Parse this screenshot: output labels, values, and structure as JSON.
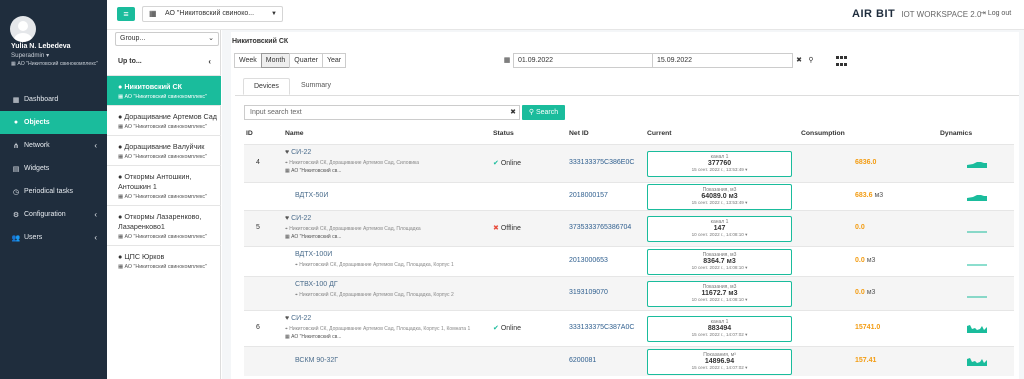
{
  "user": {
    "name": "Yulia N. Lebedeva",
    "role": "Superadmin ▾",
    "org": "АО \"Никитовский свинокомплекс\""
  },
  "menu": [
    {
      "label": "Dashboard",
      "icon": "dashboard-icon",
      "glyph": "▦",
      "arrow": ""
    },
    {
      "label": "Objects",
      "icon": "map-pin-icon",
      "glyph": "●",
      "arrow": ""
    },
    {
      "label": "Network",
      "icon": "network-icon",
      "glyph": "⋔",
      "arrow": "‹"
    },
    {
      "label": "Widgets",
      "icon": "widgets-icon",
      "glyph": "▤",
      "arrow": ""
    },
    {
      "label": "Periodical tasks",
      "icon": "clock-icon",
      "glyph": "◷",
      "arrow": ""
    },
    {
      "label": "Configuration",
      "icon": "gear-icon",
      "glyph": "⚙",
      "arrow": "‹"
    },
    {
      "label": "Users",
      "icon": "users-icon",
      "glyph": "👥",
      "arrow": "‹"
    }
  ],
  "topbar": {
    "org_select": "АО \"Никитовский свиноко...",
    "brand": "AIR BIT",
    "workspace": "IOT WORKSPACE 2.0",
    "logout": "Log out"
  },
  "groups": {
    "select": "Group...",
    "up_to": "Up to...",
    "items": [
      {
        "name": "Никитовский СК",
        "org": "АО \"Никитовский свинокомплекс\""
      },
      {
        "name": "Доращивание Артемов Сад",
        "org": "АО \"Никитовский свинокомплекс\""
      },
      {
        "name": "Доращивание Валуйчик",
        "org": "АО \"Никитовский свинокомплекс\""
      },
      {
        "name": "Откормы Антошкин, Антошкин 1",
        "org": "АО \"Никитовский свинокомплекс\""
      },
      {
        "name": "Откормы Лазаренково, Лазаренково1",
        "org": "АО \"Никитовский свинокомплекс\""
      },
      {
        "name": "ЦПС Юрков",
        "org": "АО \"Никитовский свинокомплекс\""
      }
    ]
  },
  "content": {
    "title": "Никитовский СК",
    "periods": [
      "Week",
      "Month",
      "Quarter",
      "Year"
    ],
    "date_from": "01.09.2022",
    "date_to": "15.09.2022",
    "tabs": [
      "Devices",
      "Summary"
    ],
    "search_placeholder": "Input search text",
    "search_button": "Search"
  },
  "table": {
    "headers": [
      "ID",
      "Name",
      "Status",
      "Net ID",
      "Current",
      "Consumption",
      "Dynamics"
    ],
    "rows": [
      {
        "id": "4",
        "name": "СИ-22",
        "heart": true,
        "addr": "Никитовский СК, Доращивание Артемов Сад, Силовика",
        "org": "АО \"Никитовский св...",
        "status": "Online",
        "net": "333133375C386E0C",
        "cur_label": "канал 1",
        "cur_value": "377760",
        "cur_time": "15 сент. 2022 г., 13:53:49",
        "cons_value": "6836.0",
        "cons_unit": "",
        "dyn": "bar"
      },
      {
        "id": "",
        "name": "ВДТХ-50И",
        "heart": false,
        "addr": "",
        "org": "",
        "status": "",
        "net": "2018000157",
        "cur_label": "Показания, м3",
        "cur_value": "64089.0 м3",
        "cur_time": "15 сент. 2022 г., 13:53:49",
        "cons_value": "683.6",
        "cons_unit": "м3",
        "dyn": "bar"
      },
      {
        "id": "5",
        "name": "СИ-22",
        "heart": true,
        "addr": "Никитовский СК, Доращивание Артемов Сад, Площадка",
        "org": "АО \"Никитовский св...",
        "status": "Offline",
        "net": "3735333765386704",
        "cur_label": "канал 1",
        "cur_value": "147",
        "cur_time": "10 сент. 2022 г., 14:08:10",
        "cons_value": "0.0",
        "cons_unit": "",
        "dyn": "flat"
      },
      {
        "id": "",
        "name": "ВДТХ-100И",
        "heart": false,
        "addr": "Никитовский СК, Доращивание Артемов Сад, Площадка, Корпус 1",
        "org": "",
        "status": "",
        "net": "2013000653",
        "cur_label": "Показания, м3",
        "cur_value": "8364.7 м3",
        "cur_time": "10 сент. 2022 г., 14:08:10",
        "cons_value": "0.0",
        "cons_unit": "м3",
        "dyn": "flat"
      },
      {
        "id": "",
        "name": "СТВХ-100 ДГ",
        "heart": false,
        "addr": "Никитовский СК, Доращивание Артемов Сад, Площадка, Корпус 2",
        "org": "",
        "status": "",
        "net": "3193109070",
        "cur_label": "Показания, м3",
        "cur_value": "11672.7 м3",
        "cur_time": "10 сент. 2022 г., 14:08:10",
        "cons_value": "0.0",
        "cons_unit": "м3",
        "dyn": "flat"
      },
      {
        "id": "6",
        "name": "СИ-22",
        "heart": true,
        "addr": "Никитовский СК, Доращивание Артемов Сад, Площадка, Корпус 1, Комната 1",
        "org": "АО \"Никитовский св...",
        "status": "Online",
        "net": "333133375C387A0C",
        "cur_label": "канал 1",
        "cur_value": "883494",
        "cur_time": "15 сент. 2022 г., 14:07:02",
        "cons_value": "15741.0",
        "cons_unit": "",
        "dyn": "wave"
      },
      {
        "id": "",
        "name": "ВСКМ 90-32Г",
        "heart": false,
        "addr": "",
        "org": "",
        "status": "",
        "net": "6200081",
        "cur_label": "Показания, м³",
        "cur_value": "14896.94",
        "cur_time": "15 сент. 2022 г., 14:07:02",
        "cons_value": "157.41",
        "cons_unit": "",
        "dyn": "wave"
      }
    ]
  },
  "colors": {
    "accent": "#1abc9c",
    "nav_bg": "#1f2d3d",
    "consumption": "#f39c12",
    "offline": "#e74c3c"
  }
}
